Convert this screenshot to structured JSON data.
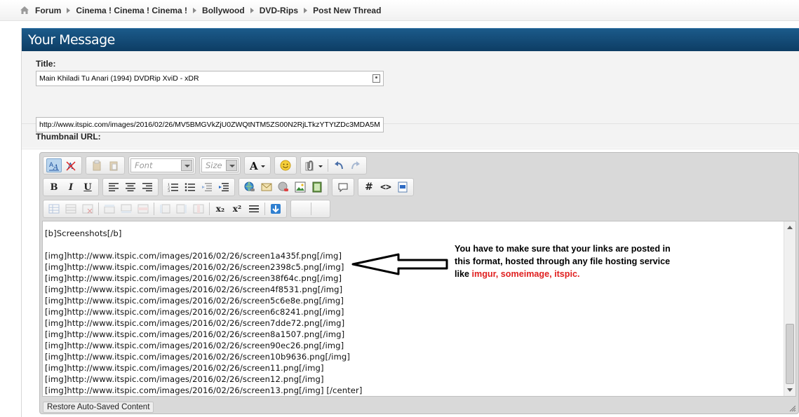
{
  "breadcrumb": {
    "items": [
      "Forum",
      "Cinema ! Cinema ! Cinema !",
      "Bollywood",
      "DVD-Rips",
      "Post New Thread"
    ]
  },
  "header": {
    "title": "Your Message"
  },
  "form": {
    "title_label": "Title:",
    "title_value": "Main Khiladi Tu Anari (1994) DVDRip XviD - xDR",
    "thumb_label": "Thumbnail URL:",
    "thumb_value": "http://www.itspic.com/images/2016/02/26/MV5BMGVkZjU0ZWQtNTM5ZS00N2RjLTkzYTYtZDc3MDA5M"
  },
  "toolbar": {
    "font_placeholder": "Font",
    "size_placeholder": "Size",
    "bold": "B",
    "italic": "I",
    "underline": "U",
    "hash": "#",
    "code": "<>",
    "sub": "x₂",
    "sup": "x²"
  },
  "editor": {
    "lines": [
      "[b]Screenshots[/b]",
      "",
      "[img]http://www.itspic.com/images/2016/02/26/screen1a435f.png[/img]",
      "[img]http://www.itspic.com/images/2016/02/26/screen2398c5.png[/img]",
      "[img]http://www.itspic.com/images/2016/02/26/screen38f64c.png[/img]",
      "[img]http://www.itspic.com/images/2016/02/26/screen4f8531.png[/img]",
      "[img]http://www.itspic.com/images/2016/02/26/screen5c6e8e.png[/img]",
      "[img]http://www.itspic.com/images/2016/02/26/screen6c8241.png[/img]",
      "[img]http://www.itspic.com/images/2016/02/26/screen7dde72.png[/img]",
      "[img]http://www.itspic.com/images/2016/02/26/screen8a1507.png[/img]",
      "[img]http://www.itspic.com/images/2016/02/26/screen90ec26.png[/img]",
      "[img]http://www.itspic.com/images/2016/02/26/screen10b9636.png[/img]",
      "[img]http://www.itspic.com/images/2016/02/26/screen11.png[/img]",
      "[img]http://www.itspic.com/images/2016/02/26/screen12.png[/img]",
      "[img]http://www.itspic.com/images/2016/02/26/screen13.png[/img] [/center]"
    ],
    "restore_label": "Restore Auto-Saved Content"
  },
  "annotation": {
    "line1": "You have to make sure that your links are posted in",
    "line2": "this format, hosted through any file hosting service",
    "line3_prefix": "like ",
    "line3_highlight": "imgur, someimage, itspic."
  },
  "colors": {
    "header_bg": "#0d3d64",
    "annotation_highlight": "#e02020"
  }
}
